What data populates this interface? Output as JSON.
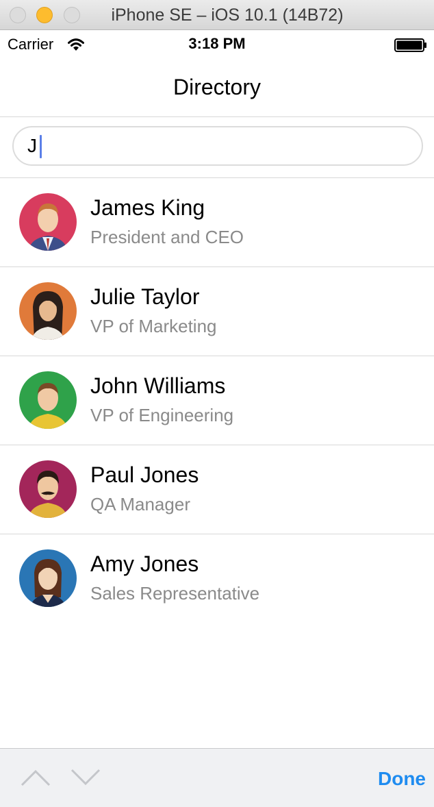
{
  "window": {
    "title": "iPhone SE – iOS 10.1 (14B72)"
  },
  "status_bar": {
    "carrier": "Carrier",
    "time": "3:18 PM"
  },
  "nav": {
    "title": "Directory"
  },
  "search": {
    "value": "J"
  },
  "employees": [
    {
      "name": "James King",
      "title": "President and CEO",
      "avatar_bg": "#d83c5e"
    },
    {
      "name": "Julie Taylor",
      "title": "VP of Marketing",
      "avatar_bg": "#e07a3a"
    },
    {
      "name": "John Williams",
      "title": "VP of Engineering",
      "avatar_bg": "#2fa24a"
    },
    {
      "name": "Paul Jones",
      "title": "QA Manager",
      "avatar_bg": "#a3265a"
    },
    {
      "name": "Amy Jones",
      "title": "Sales Representative",
      "avatar_bg": "#2a76b5"
    }
  ],
  "accessory": {
    "done_label": "Done"
  },
  "colors": {
    "accent": "#1f8cf0",
    "caret": "#5b7fe8",
    "subtitle": "#8a8a8a"
  }
}
